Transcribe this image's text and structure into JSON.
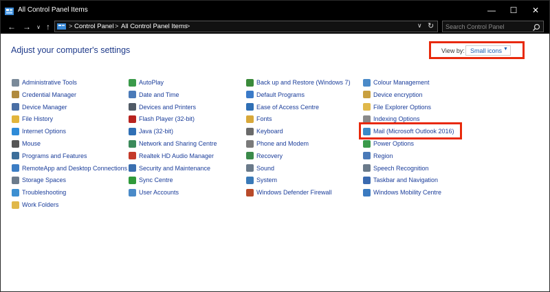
{
  "window": {
    "title": "All Control Panel Items"
  },
  "titlebar_buttons": {
    "minimize": "—",
    "maximize": "☐",
    "close": "✕"
  },
  "nav": {
    "back": "←",
    "forward": "→",
    "dropdown": "∨",
    "up": "↑"
  },
  "address": {
    "breadcrumbs": [
      "Control Panel",
      "All Control Panel Items"
    ],
    "separator": ">"
  },
  "search": {
    "placeholder": "Search Control Panel"
  },
  "heading": "Adjust your computer's settings",
  "view_by": {
    "label": "View by:",
    "value": "Small icons"
  },
  "columns": [
    [
      {
        "label": "Administrative Tools",
        "icon": "admin-tools-icon",
        "color": "#7a8a99"
      },
      {
        "label": "Credential Manager",
        "icon": "credential-manager-icon",
        "color": "#b08a3e"
      },
      {
        "label": "Device Manager",
        "icon": "device-manager-icon",
        "color": "#4a6fa5"
      },
      {
        "label": "File History",
        "icon": "file-history-icon",
        "color": "#e2b53b"
      },
      {
        "label": "Internet Options",
        "icon": "internet-options-icon",
        "color": "#2e8bd8"
      },
      {
        "label": "Mouse",
        "icon": "mouse-icon",
        "color": "#555555"
      },
      {
        "label": "Programs and Features",
        "icon": "programs-features-icon",
        "color": "#3c6e9a"
      },
      {
        "label": "RemoteApp and Desktop Connections",
        "icon": "remoteapp-icon",
        "color": "#3b7dc4"
      },
      {
        "label": "Storage Spaces",
        "icon": "storage-spaces-icon",
        "color": "#6b7b8c"
      },
      {
        "label": "Troubleshooting",
        "icon": "troubleshooting-icon",
        "color": "#3d8fd1"
      },
      {
        "label": "Work Folders",
        "icon": "work-folders-icon",
        "color": "#e0b84a"
      }
    ],
    [
      {
        "label": "AutoPlay",
        "icon": "autoplay-icon",
        "color": "#3a9a4a"
      },
      {
        "label": "Date and Time",
        "icon": "date-time-icon",
        "color": "#4a7ab8"
      },
      {
        "label": "Devices and Printers",
        "icon": "devices-printers-icon",
        "color": "#505a66"
      },
      {
        "label": "Flash Player (32-bit)",
        "icon": "flash-player-icon",
        "color": "#b8231e"
      },
      {
        "label": "Java (32-bit)",
        "icon": "java-icon",
        "color": "#2f6fb5"
      },
      {
        "label": "Network and Sharing Centre",
        "icon": "network-sharing-icon",
        "color": "#3b8a5a"
      },
      {
        "label": "Realtek HD Audio Manager",
        "icon": "realtek-audio-icon",
        "color": "#c43a2a"
      },
      {
        "label": "Security and Maintenance",
        "icon": "security-maintenance-icon",
        "color": "#3a6fb0"
      },
      {
        "label": "Sync Centre",
        "icon": "sync-centre-icon",
        "color": "#2f9a3a"
      },
      {
        "label": "User Accounts",
        "icon": "user-accounts-icon",
        "color": "#4a8ac8"
      }
    ],
    [
      {
        "label": "Back up and Restore (Windows 7)",
        "icon": "backup-restore-icon",
        "color": "#3a8a3a"
      },
      {
        "label": "Default Programs",
        "icon": "default-programs-icon",
        "color": "#3a7ac8"
      },
      {
        "label": "Ease of Access Centre",
        "icon": "ease-of-access-icon",
        "color": "#2f6fb5"
      },
      {
        "label": "Fonts",
        "icon": "fonts-icon",
        "color": "#d8a83a"
      },
      {
        "label": "Keyboard",
        "icon": "keyboard-icon",
        "color": "#6a6a6a"
      },
      {
        "label": "Phone and Modem",
        "icon": "phone-modem-icon",
        "color": "#7a7a7a"
      },
      {
        "label": "Recovery",
        "icon": "recovery-icon",
        "color": "#3a8a4a"
      },
      {
        "label": "Sound",
        "icon": "sound-icon",
        "color": "#6a7a8a"
      },
      {
        "label": "System",
        "icon": "system-icon",
        "color": "#3a7ab8"
      },
      {
        "label": "Windows Defender Firewall",
        "icon": "firewall-icon",
        "color": "#b84a2a"
      }
    ],
    [
      {
        "label": "Colour Management",
        "icon": "colour-management-icon",
        "color": "#4a8ac8"
      },
      {
        "label": "Device encryption",
        "icon": "device-encryption-icon",
        "color": "#c8a040"
      },
      {
        "label": "File Explorer Options",
        "icon": "file-explorer-options-icon",
        "color": "#e0b84a"
      },
      {
        "label": "Indexing Options",
        "icon": "indexing-options-icon",
        "color": "#8a8a8a"
      },
      {
        "label": "Mail (Microsoft Outlook 2016)",
        "icon": "mail-icon",
        "color": "#3a8ac8"
      },
      {
        "label": "Power Options",
        "icon": "power-options-icon",
        "color": "#3a9a4a"
      },
      {
        "label": "Region",
        "icon": "region-icon",
        "color": "#4a7ab8"
      },
      {
        "label": "Speech Recognition",
        "icon": "speech-recognition-icon",
        "color": "#6a7a8a"
      },
      {
        "label": "Taskbar and Navigation",
        "icon": "taskbar-navigation-icon",
        "color": "#3a6ab0"
      },
      {
        "label": "Windows Mobility Centre",
        "icon": "mobility-centre-icon",
        "color": "#3a7ac0"
      }
    ]
  ],
  "colors": {
    "highlight": "#e8290b",
    "link": "#1a3d9a",
    "heading": "#1e3a8a"
  }
}
